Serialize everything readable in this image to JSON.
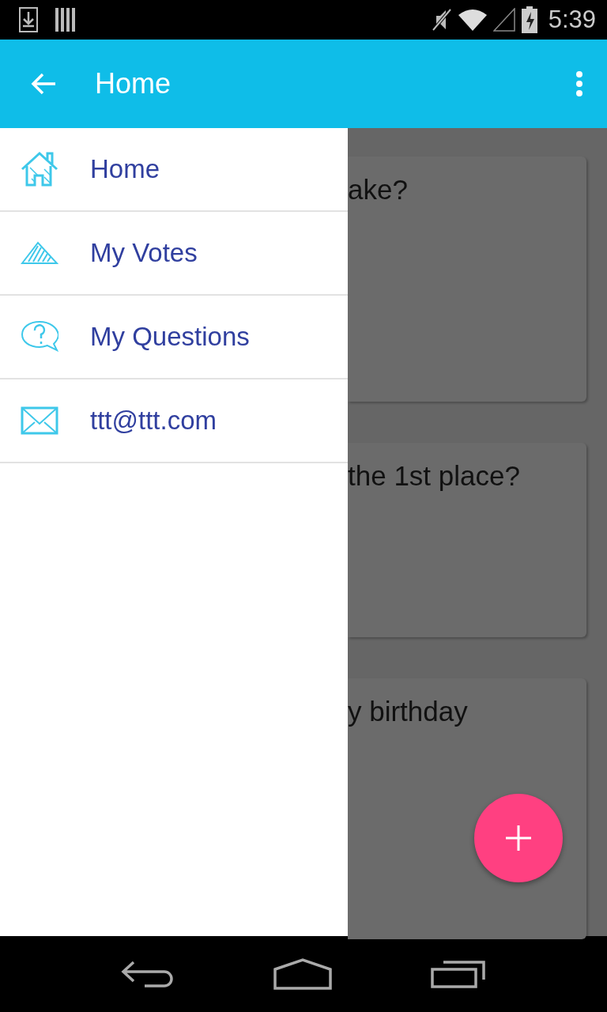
{
  "status_bar": {
    "time": "5:39"
  },
  "app_bar": {
    "title": "Home"
  },
  "drawer": {
    "items": [
      {
        "label": "Home"
      },
      {
        "label": "My Votes"
      },
      {
        "label": "My Questions"
      },
      {
        "label": "ttt@ttt.com"
      }
    ]
  },
  "cards": [
    {
      "title": "ake?"
    },
    {
      "title": "the 1st place?"
    },
    {
      "title": "y birthday"
    }
  ]
}
